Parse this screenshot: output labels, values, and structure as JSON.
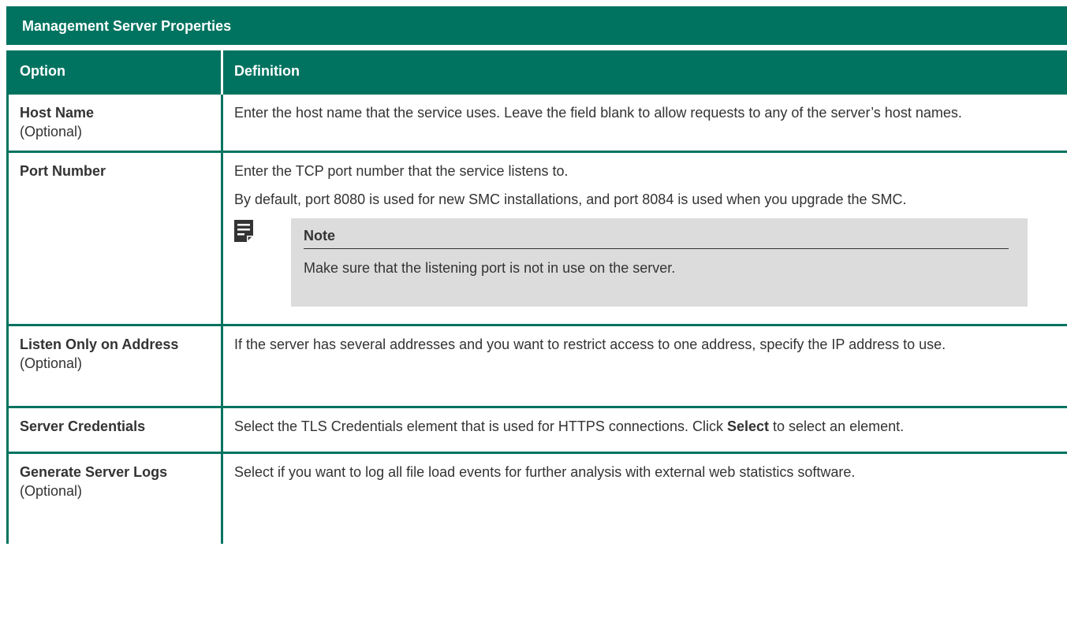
{
  "section_title": "Management Server Properties",
  "table": {
    "headers": [
      "Option",
      "Definition"
    ],
    "rows": [
      {
        "option": "Host Name",
        "sub": "(Optional)",
        "definition": [
          "Enter the host name that the service uses. Leave the field blank to allow requests to any of the server’s host names."
        ]
      },
      {
        "option": "Port Number",
        "sub": "",
        "definition": [
          "Enter the TCP port number that the service listens to.",
          "By default, port 8080 is used for new SMC installations, and port 8084 is used when you upgrade the SMC."
        ],
        "note": {
          "title": "Note",
          "text": "Make sure that the listening port is not in use on the server.",
          "icon": "note-icon"
        }
      },
      {
        "option": "Listen Only on Address",
        "sub": "(Optional)",
        "definition": [
          "If the server has several addresses and you want to restrict access to one address, specify the IP address to use."
        ]
      },
      {
        "option": "Server Credentials",
        "sub": "",
        "definition_parts": {
          "before": "Select the TLS Credentials element that is used for HTTPS connections. Click ",
          "bold": "Select",
          "after": " to select an element."
        }
      },
      {
        "option": "Generate Server Logs",
        "sub": "(Optional)",
        "definition": [
          "Select if you want to log all file load events for further analysis with external web statistics software."
        ]
      }
    ]
  },
  "colors": {
    "header_bg": "#007360",
    "border": "#007360",
    "note_bg": "#dcdcdc",
    "text": "#333333"
  }
}
